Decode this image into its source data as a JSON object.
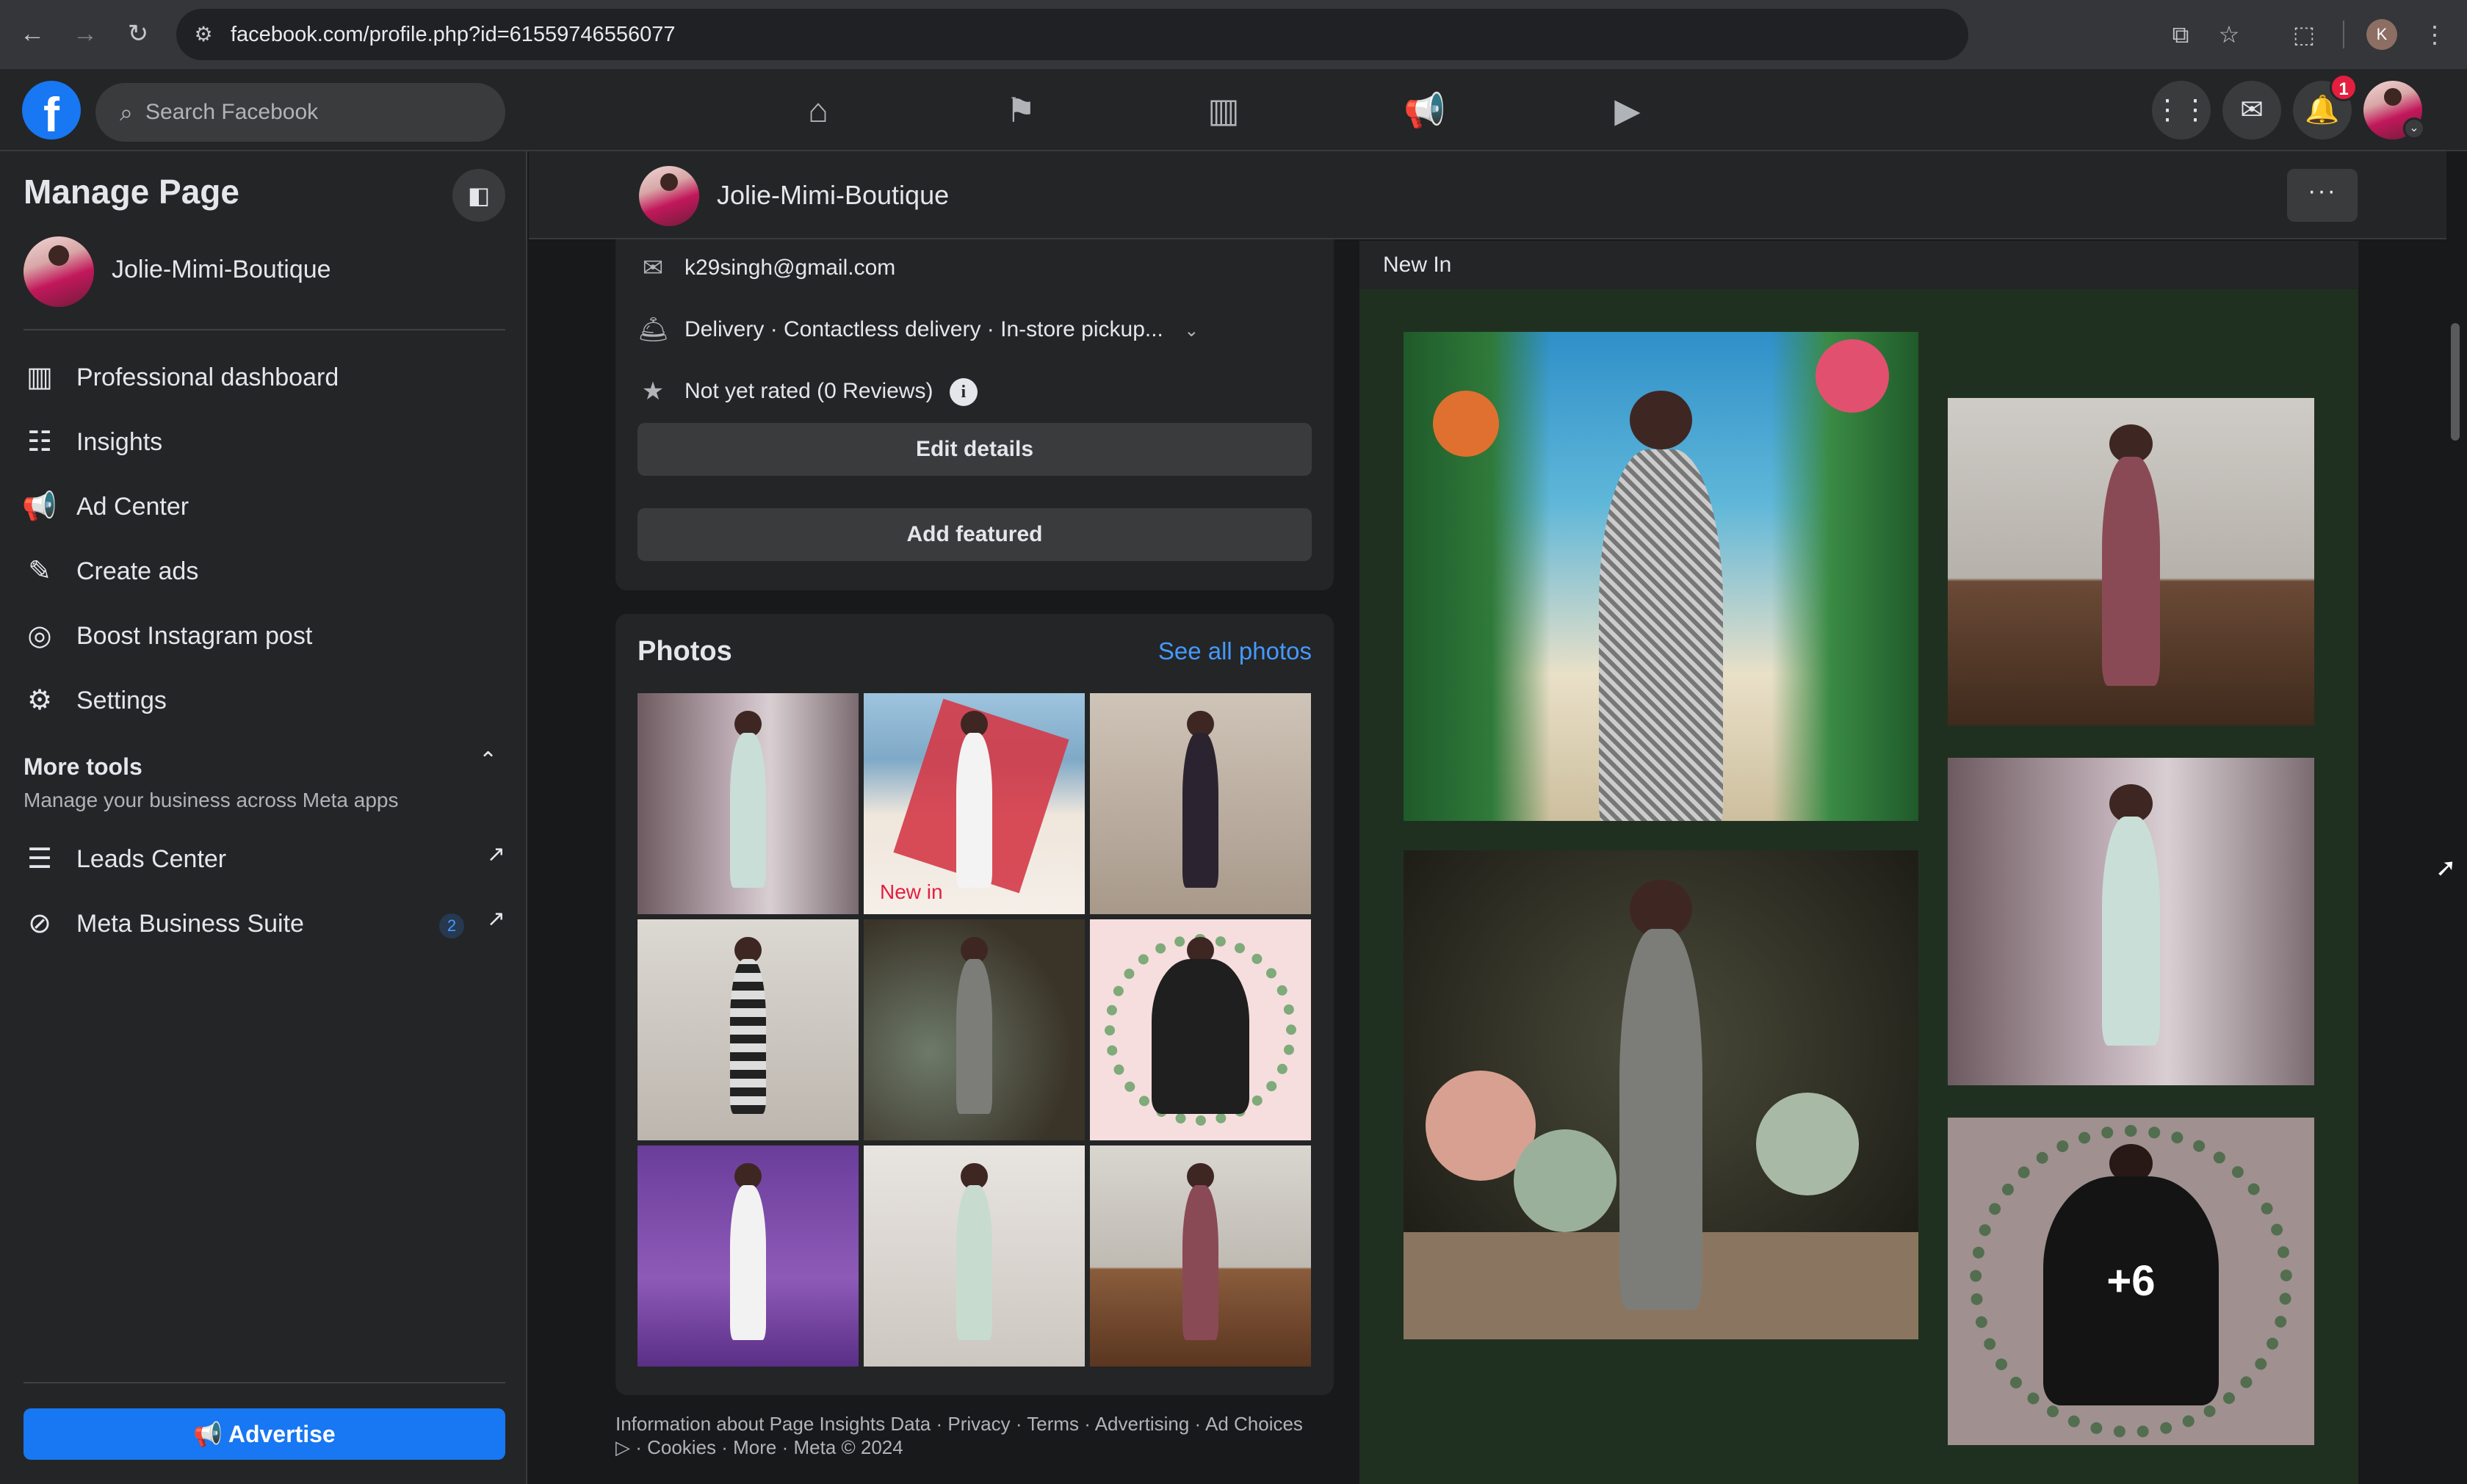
{
  "browser": {
    "url": "facebook.com/profile.php?id=61559746556077",
    "profile_initial": "K"
  },
  "fb_header": {
    "search_placeholder": "Search Facebook",
    "notification_count": "1"
  },
  "sidebar": {
    "title": "Manage Page",
    "page_name": "Jolie-Mimi-Boutique",
    "items": [
      {
        "label": "Professional dashboard",
        "icon": "dashboard-icon"
      },
      {
        "label": "Insights",
        "icon": "insights-icon"
      },
      {
        "label": "Ad Center",
        "icon": "megaphone-icon"
      },
      {
        "label": "Create ads",
        "icon": "pencil-icon"
      },
      {
        "label": "Boost Instagram post",
        "icon": "instagram-icon"
      },
      {
        "label": "Settings",
        "icon": "gear-icon"
      }
    ],
    "more_tools": {
      "title": "More tools",
      "subtitle": "Manage your business across Meta apps",
      "items": [
        {
          "label": "Leads Center",
          "icon": "leads-icon"
        },
        {
          "label": "Meta Business Suite",
          "icon": "meta-icon",
          "count": "2"
        }
      ]
    },
    "advertise_label": "Advertise"
  },
  "page_bar": {
    "page_name": "Jolie-Mimi-Boutique",
    "more_label": "···"
  },
  "intro": {
    "email": "k29singh@gmail.com",
    "services": "Delivery · Contactless delivery · In-store pickup...",
    "rating": "Not yet rated (0 Reviews)",
    "edit_details": "Edit details",
    "add_featured": "Add featured"
  },
  "photos": {
    "title": "Photos",
    "see_all": "See all photos",
    "new_in_caption": "New in"
  },
  "footer": {
    "line1": "Information about Page Insights Data · Privacy · Terms · Advertising · Ad Choices",
    "line2": "▷ · Cookies · More · Meta © 2024"
  },
  "album": {
    "title": "New In",
    "more_count": "+6"
  },
  "colors": {
    "accent": "#1877f2",
    "link": "#4599ff",
    "badge": "#e41e3f"
  }
}
